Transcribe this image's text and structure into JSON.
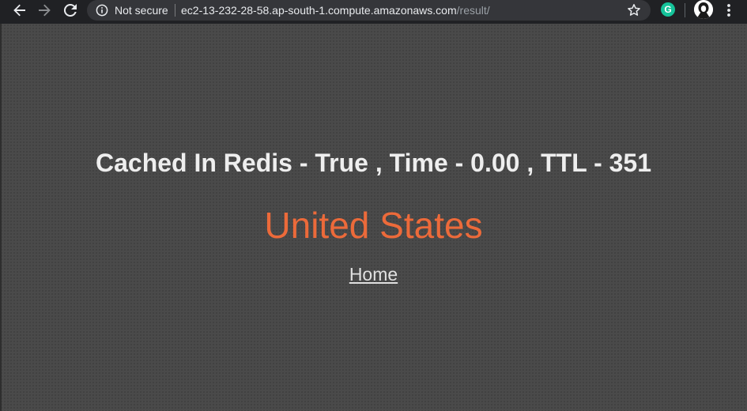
{
  "browser": {
    "security_label": "Not secure",
    "url_host": "ec2-13-232-28-58.ap-south-1.compute.amazonaws.com",
    "url_path": "/result/",
    "grammarly_letter": "G",
    "icons": [
      "back-arrow-icon",
      "forward-arrow-icon",
      "reload-icon",
      "info-icon",
      "star-icon",
      "grammarly-icon",
      "profile-avatar-icon",
      "more-vert-icon"
    ]
  },
  "page": {
    "heading": "Cached In Redis - True , Time - 0.00 , TTL - 351",
    "country": "United States",
    "home_link": "Home"
  },
  "colors": {
    "page_background": "#4a4a4a",
    "country_text": "#ec6a3a",
    "heading_text": "#eeeeee",
    "toolbar": "#202124",
    "omnibox": "#35363a"
  }
}
